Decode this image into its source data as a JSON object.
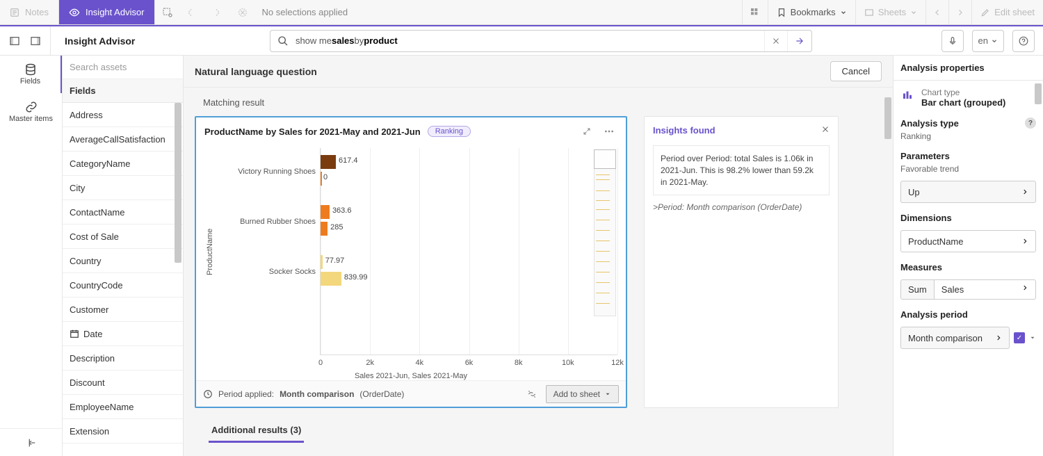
{
  "topbar": {
    "notes": "Notes",
    "insight_advisor": "Insight Advisor",
    "no_selections": "No selections applied",
    "bookmarks": "Bookmarks",
    "sheets": "Sheets",
    "edit_sheet": "Edit sheet"
  },
  "subbar": {
    "title": "Insight Advisor",
    "search_pre": "show me ",
    "search_hl1": "sales",
    "search_mid": " by ",
    "search_hl2": "product",
    "lang": "en"
  },
  "leftnav": {
    "fields": "Fields",
    "master": "Master items"
  },
  "assets": {
    "search_placeholder": "Search assets",
    "header": "Fields",
    "items": [
      "Address",
      "AverageCallSatisfaction",
      "CategoryName",
      "City",
      "ContactName",
      "Cost of Sale",
      "Country",
      "CountryCode",
      "Customer",
      "Date",
      "Description",
      "Discount",
      "EmployeeName",
      "Extension"
    ],
    "date_index": 9
  },
  "main": {
    "nlq": "Natural language question",
    "cancel": "Cancel",
    "matching": "Matching result",
    "chart_title": "ProductName by Sales for 2021-May and 2021-Jun",
    "ranking": "Ranking",
    "y_axis": "ProductName",
    "x_axis": "Sales 2021-Jun, Sales 2021-May",
    "footer_applied": "Period applied:",
    "footer_bold": "Month comparison",
    "footer_order": "(OrderDate)",
    "add_to_sheet": "Add to sheet",
    "insights_title": "Insights found",
    "insight_text": "Period over Period: total Sales is 1.06k in 2021-Jun. This is 98.2% lower than 59.2k in 2021-May.",
    "period_note": ">Period: Month comparison (OrderDate)",
    "additional": "Additional results (3)"
  },
  "chart_data": {
    "type": "bar",
    "orientation": "horizontal_grouped",
    "y_title": "ProductName",
    "x_title": "Sales 2021-Jun, Sales 2021-May",
    "x_ticks": [
      "0",
      "2k",
      "4k",
      "6k",
      "8k",
      "10k",
      "12k"
    ],
    "x_range": [
      0,
      12000
    ],
    "categories": [
      "Victory Running Shoes",
      "Burned Rubber Shoes",
      "Socker Socks"
    ],
    "series": [
      {
        "name": "2021-Jun",
        "color": "#7a3b0f",
        "values": [
          617.4,
          363.6,
          77.97
        ]
      },
      {
        "name": "2021-May",
        "color": "#ee7c1e",
        "alt_colors": [
          null,
          null,
          "#f3d77d"
        ],
        "values": [
          0,
          285,
          839.99
        ]
      }
    ],
    "value_labels": [
      [
        "617.4",
        "0"
      ],
      [
        "363.6",
        "285"
      ],
      [
        "77.97",
        "839.99"
      ]
    ]
  },
  "props": {
    "title": "Analysis properties",
    "chart_type_label": "Chart type",
    "chart_type_value": "Bar chart (grouped)",
    "analysis_type_label": "Analysis type",
    "analysis_type_value": "Ranking",
    "params_label": "Parameters",
    "fav_trend_label": "Favorable trend",
    "fav_trend_value": "Up",
    "dims_label": "Dimensions",
    "dim_value": "ProductName",
    "meas_label": "Measures",
    "meas_agg": "Sum",
    "meas_field": "Sales",
    "period_label": "Analysis period",
    "period_value": "Month comparison"
  }
}
